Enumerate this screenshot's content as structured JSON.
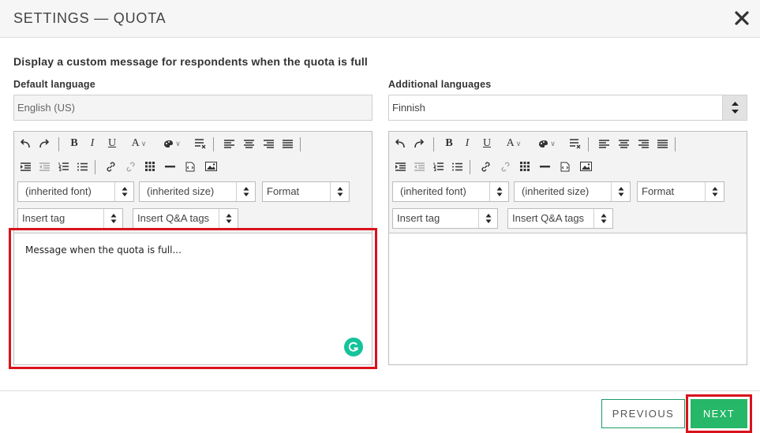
{
  "dialog": {
    "title": "SETTINGS — QUOTA",
    "heading": "Display a custom message for respondents when the quota is full"
  },
  "default_language": {
    "label": "Default language",
    "value": "English (US)"
  },
  "additional_languages": {
    "label": "Additional languages",
    "selected": "Finnish"
  },
  "toolbar": {
    "font": "(inherited font)",
    "size": "(inherited size)",
    "format": "Format",
    "insert_tag": "Insert tag",
    "insert_qa_tags": "Insert Q&A tags",
    "icons": [
      "undo-icon",
      "redo-icon",
      "bold-icon",
      "italic-icon",
      "underline-icon",
      "text-color-icon",
      "background-color-icon",
      "clear-format-icon",
      "align-left-icon",
      "align-center-icon",
      "align-right-icon",
      "justify-icon",
      "outdent-icon",
      "indent-icon",
      "numbered-list-icon",
      "bullet-list-icon",
      "link-icon",
      "unlink-icon",
      "table-icon",
      "horizontal-rule-icon",
      "source-icon",
      "image-icon"
    ]
  },
  "editor_left": {
    "message": "Message when the quota is full..."
  },
  "colors": {
    "highlight": "#d9121c",
    "next_button": "#26b768",
    "grammarly": "#15c39a"
  },
  "footer": {
    "previous_label": "PREVIOUS",
    "next_label": "NEXT"
  }
}
